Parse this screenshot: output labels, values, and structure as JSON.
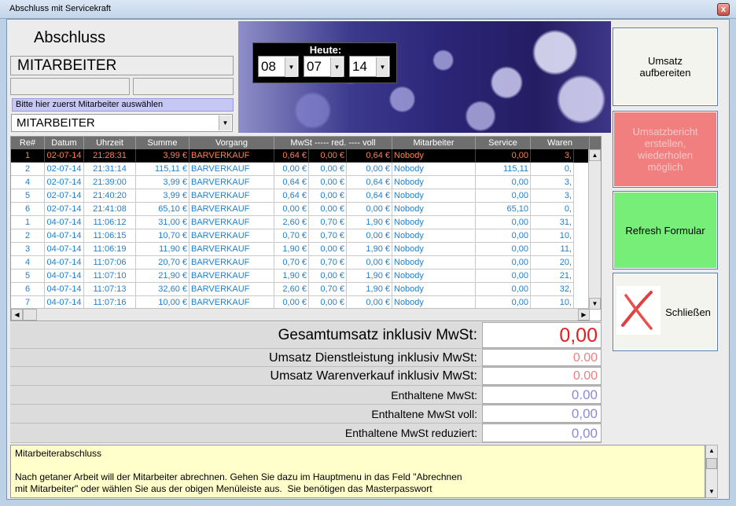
{
  "window": {
    "title": "Abschluss mit Servicekraft",
    "close_glyph": "x"
  },
  "header": {
    "title": "Abschluss",
    "employee_display": "MITARBEITER",
    "hint": "Bitte hier zuerst Mitarbeiter auswählen",
    "employee_select": "MITARBEITER"
  },
  "date_picker": {
    "label": "Heute:",
    "day": "08",
    "month": "07",
    "year": "14"
  },
  "table": {
    "columns": [
      "Re#",
      "Datum",
      "Uhrzeit",
      "Summe",
      "Vorgang",
      "MwSt ----- red. ---- voll",
      "Mitarbeiter",
      "Service",
      "Waren"
    ],
    "rows": [
      [
        "1",
        "02-07-14",
        "21:28:31",
        "3,99 €",
        "BARVERKAUF",
        "0,64 €",
        "0,00 €",
        "0,64 €",
        "Nobody",
        "0,00",
        "3,"
      ],
      [
        "2",
        "02-07-14",
        "21:31:14",
        "115,11 €",
        "BARVERKAUF",
        "0,00 €",
        "0,00 €",
        "0,00 €",
        "Nobody",
        "115,11",
        "0,"
      ],
      [
        "4",
        "02-07-14",
        "21:39:00",
        "3,99 €",
        "BARVERKAUF",
        "0,64 €",
        "0,00 €",
        "0,64 €",
        "Nobody",
        "0,00",
        "3,"
      ],
      [
        "5",
        "02-07-14",
        "21:40:20",
        "3,99 €",
        "BARVERKAUF",
        "0,64 €",
        "0,00 €",
        "0,64 €",
        "Nobody",
        "0,00",
        "3,"
      ],
      [
        "6",
        "02-07-14",
        "21:41:08",
        "65,10 €",
        "BARVERKAUF",
        "0,00 €",
        "0,00 €",
        "0,00 €",
        "Nobody",
        "65,10",
        "0,"
      ],
      [
        "1",
        "04-07-14",
        "11:06:12",
        "31,00 €",
        "BARVERKAUF",
        "2,60 €",
        "0,70 €",
        "1,90 €",
        "Nobody",
        "0,00",
        "31,"
      ],
      [
        "2",
        "04-07-14",
        "11:06:15",
        "10,70 €",
        "BARVERKAUF",
        "0,70 €",
        "0,70 €",
        "0,00 €",
        "Nobody",
        "0,00",
        "10,"
      ],
      [
        "3",
        "04-07-14",
        "11:06:19",
        "11,90 €",
        "BARVERKAUF",
        "1,90 €",
        "0,00 €",
        "1,90 €",
        "Nobody",
        "0,00",
        "11,"
      ],
      [
        "4",
        "04-07-14",
        "11:07:06",
        "20,70 €",
        "BARVERKAUF",
        "0,70 €",
        "0,70 €",
        "0,00 €",
        "Nobody",
        "0,00",
        "20,"
      ],
      [
        "5",
        "04-07-14",
        "11:07:10",
        "21,90 €",
        "BARVERKAUF",
        "1,90 €",
        "0,00 €",
        "1,90 €",
        "Nobody",
        "0,00",
        "21,"
      ],
      [
        "6",
        "04-07-14",
        "11:07:13",
        "32,60 €",
        "BARVERKAUF",
        "2,60 €",
        "0,70 €",
        "1,90 €",
        "Nobody",
        "0,00",
        "32,"
      ],
      [
        "7",
        "04-07-14",
        "11:07:16",
        "10,00 €",
        "BARVERKAUF",
        "0,00 €",
        "0,00 €",
        "0,00 €",
        "Nobody",
        "0,00",
        "10,"
      ]
    ],
    "selected_row": 0
  },
  "totals": [
    {
      "label": "Gesamtumsatz inklusiv MwSt:",
      "value": "0,00",
      "color": "#e02020"
    },
    {
      "label": "Umsatz Dienstleistung inklusiv MwSt:",
      "value": "0.00",
      "color": "#f08080"
    },
    {
      "label": "Umsatz Warenverkauf inklusiv MwSt:",
      "value": "0.00",
      "color": "#f08080"
    },
    {
      "label": "Enthaltene MwSt:",
      "value": "0.00",
      "color": "#8a8ad0"
    },
    {
      "label": "Enthaltene MwSt voll:",
      "value": "0,00",
      "color": "#8a8ad0"
    },
    {
      "label": "Enthaltene MwSt reduziert:",
      "value": "0,00",
      "color": "#8a8ad0"
    }
  ],
  "info_text": "Mitarbeiterabschluss\n\nNach getaner Arbeit will der Mitarbeiter abrechnen. Gehen Sie dazu im Hauptmenu in das Feld \"Abrechnen\nmit Mitarbeiter\" oder wählen Sie aus der obigen Menüleiste aus.  Sie benötigen das Masterpasswort",
  "buttons": {
    "umsatz": "Umsatz\naufbereiten",
    "bericht": "Umsatzbericht\nerstellen,\nwiederholen\nmöglich",
    "refresh": "Refresh Formular",
    "schliessen": "Schließen"
  },
  "colors": {
    "bericht_bg": "#f27f80",
    "refresh_bg": "#77ee77",
    "umsatz_bg": "#f4f4ef"
  }
}
